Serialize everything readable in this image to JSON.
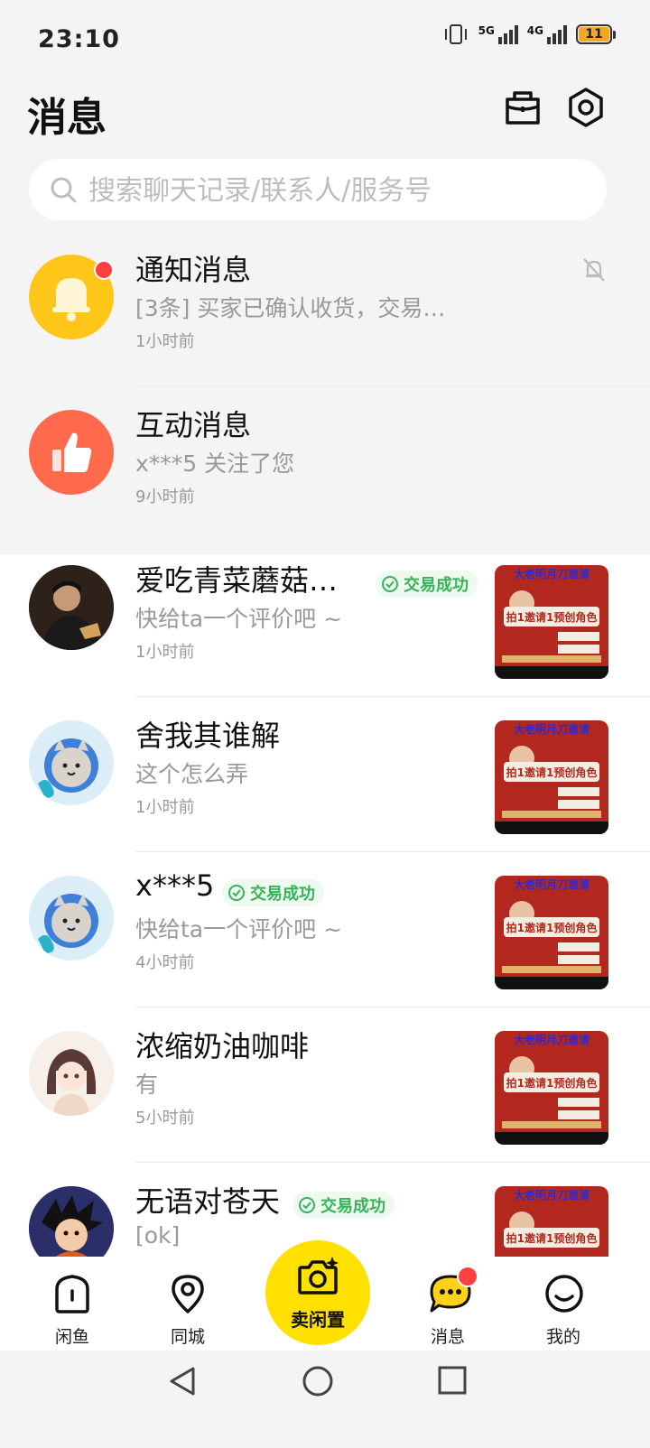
{
  "status_bar": {
    "time": "23:10",
    "net1": "5G",
    "net2": "4G",
    "battery": "11"
  },
  "header": {
    "title": "消息"
  },
  "search": {
    "placeholder": "搜索聊天记录/联系人/服务号"
  },
  "system_rows": [
    {
      "name": "通知消息",
      "preview": "[3条] 买家已确认收货，交易…",
      "time": "1小时前"
    },
    {
      "name": "互动消息",
      "preview": "x***5 关注了您",
      "time": "9小时前"
    }
  ],
  "chats": [
    {
      "name": "爱吃青菜蘑菇…",
      "badge": "交易成功",
      "preview": "快给ta一个评价吧 ~",
      "time": "1小时前"
    },
    {
      "name": "舍我其谁解",
      "badge": "",
      "preview": "这个怎么弄",
      "time": "1小时前"
    },
    {
      "name": "x***5",
      "badge": "交易成功",
      "preview": "快给ta一个评价吧 ~",
      "time": "4小时前"
    },
    {
      "name": "浓缩奶油咖啡",
      "badge": "",
      "preview": "有",
      "time": "5小时前"
    },
    {
      "name": "无语对苍天",
      "badge": "交易成功",
      "preview": "[ok]",
      "time": ""
    }
  ],
  "thumb_text": {
    "top": "大老明月刀邀请",
    "mid": "拍1邀请1预创角色"
  },
  "bottom_nav": {
    "home": "闲鱼",
    "city": "同城",
    "sell": "卖闲置",
    "messages": "消息",
    "mine": "我的"
  },
  "colors": {
    "accent_yellow": "#ffe000",
    "badge_green": "#37b35a",
    "notify_orange": "#ff6a4d"
  }
}
